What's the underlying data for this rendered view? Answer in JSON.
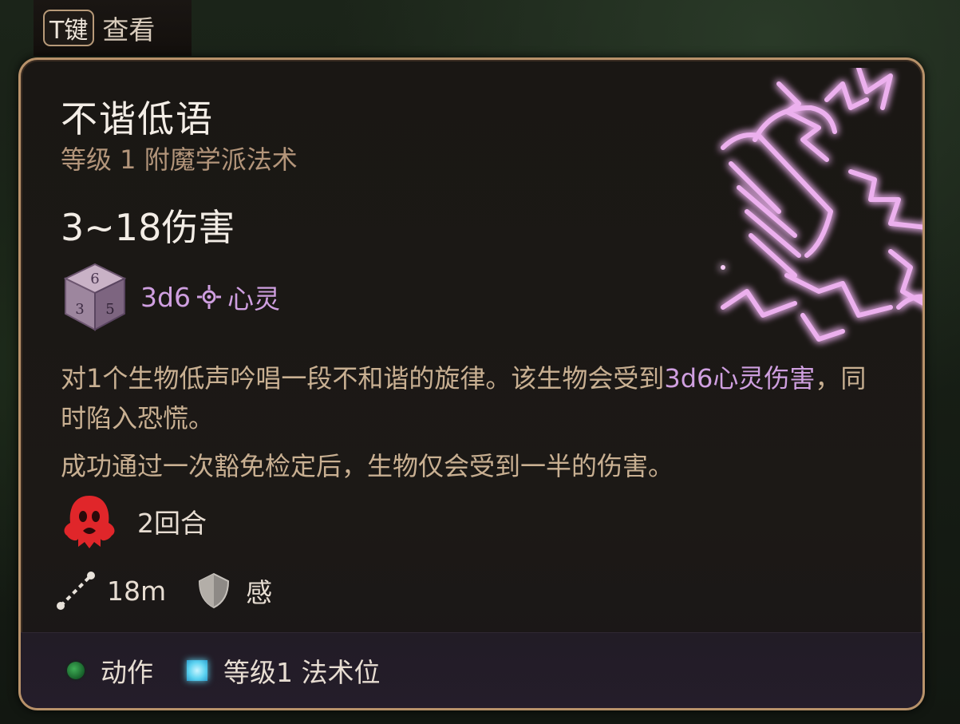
{
  "hotkey": {
    "key": "T键",
    "label": "查看"
  },
  "spell": {
    "name": "不谐低语",
    "subtitle": "等级 1 附魔学派法术",
    "damage_total": "3~18伤害",
    "dice_formula": "3d6",
    "damage_type": "心灵",
    "description_1a": "对1个生物低声吟唱一段不和谐的旋律。该生物会受到",
    "description_1b": "3d6心灵伤害",
    "description_1c": "，同时陷入恐慌。",
    "description_2": "成功通过一次豁免检定后，生物仅会受到一半的伤害。",
    "status_duration": "2回合",
    "range": "18m",
    "save_ability": "感"
  },
  "footer": {
    "action_label": "动作",
    "slot_label": "等级1 法术位"
  },
  "colors": {
    "border": "#b8926a",
    "psychic": "#cf9fe0",
    "fear": "#e0262a",
    "action_dot": "#2f8e47",
    "spell_slot": "#5fd4f1"
  },
  "icons": {
    "dice": "d6-dice-icon",
    "damage_type": "psychic-damage-icon",
    "status": "fear-condition-icon",
    "range": "range-icon",
    "save": "saving-throw-icon",
    "spell_art": "dissonant-whispers-spell-icon"
  }
}
